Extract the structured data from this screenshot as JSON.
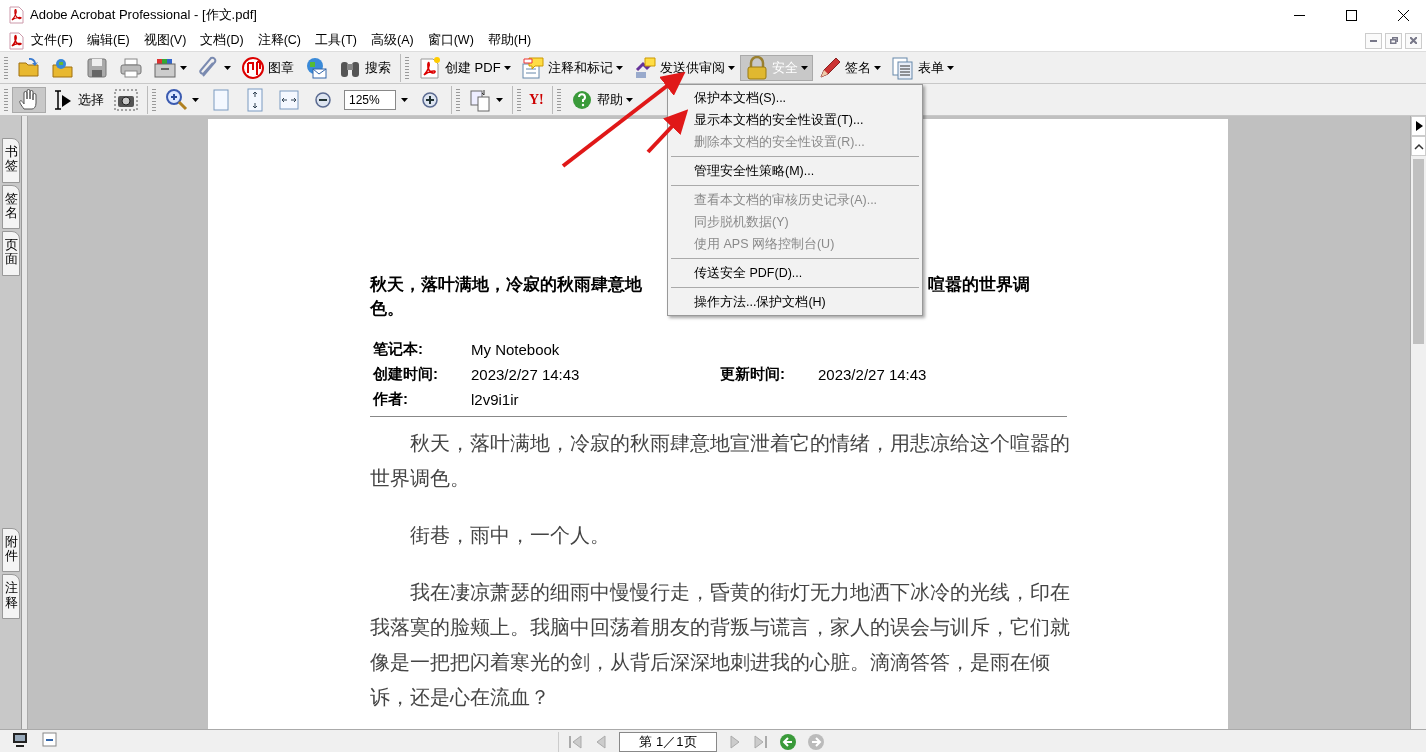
{
  "window": {
    "title": "Adobe Acrobat Professional - [作文.pdf]"
  },
  "menu_bar": [
    "文件(F)",
    "编辑(E)",
    "视图(V)",
    "文档(D)",
    "注释(C)",
    "工具(T)",
    "高级(A)",
    "窗口(W)",
    "帮助(H)"
  ],
  "toolbar_1": [
    {
      "kind": "icon",
      "selected": false
    },
    {
      "kind": "icon",
      "selected": false
    },
    {
      "kind": "icon",
      "selected": false
    },
    {
      "kind": "icon",
      "selected": false
    },
    {
      "kind": "dropdown",
      "selected": false
    },
    {
      "kind": "dropdown",
      "selected": false
    },
    {
      "kind": "labeled",
      "label": "图章",
      "selected": false
    },
    {
      "kind": "icon",
      "selected": false
    },
    {
      "kind": "labeled",
      "label": "搜索",
      "selected": false
    },
    {
      "kind": "separator"
    },
    {
      "kind": "labeled-dropdown",
      "label": "创建 PDF",
      "selected": false
    },
    {
      "kind": "labeled-dropdown",
      "label": "注释和标记",
      "selected": false
    },
    {
      "kind": "labeled-dropdown",
      "label": "发送供审阅",
      "selected": false
    },
    {
      "kind": "labeled-dropdown",
      "label": "安全",
      "selected": true
    },
    {
      "kind": "labeled-dropdown",
      "label": "签名",
      "selected": false
    },
    {
      "kind": "labeled-dropdown",
      "label": "表单",
      "selected": false
    }
  ],
  "toolbar_2": [
    {
      "kind": "icon",
      "selected": true
    },
    {
      "kind": "labeled",
      "label": "选择",
      "selected": false
    },
    {
      "kind": "icon",
      "selected": false
    },
    {
      "kind": "separator"
    },
    {
      "kind": "dropdown",
      "selected": false
    },
    {
      "kind": "icon",
      "selected": false
    },
    {
      "kind": "icon",
      "selected": false
    },
    {
      "kind": "icon",
      "selected": false
    },
    {
      "kind": "icon",
      "selected": false
    },
    {
      "kind": "zoom-field",
      "value": "125%"
    },
    {
      "kind": "icon",
      "selected": false
    },
    {
      "kind": "separator"
    },
    {
      "kind": "dropdown",
      "selected": false
    },
    {
      "kind": "separator"
    },
    {
      "kind": "text-logo",
      "label": "Y!"
    },
    {
      "kind": "separator"
    },
    {
      "kind": "labeled-dropdown",
      "label": "帮助",
      "selected": false
    }
  ],
  "side_tabs_top": [
    "书签",
    "签名",
    "页面"
  ],
  "side_tabs_bottom": [
    "附件",
    "注释"
  ],
  "security_menu": [
    {
      "kind": "item",
      "label": "保护本文档(S)...",
      "disabled": false
    },
    {
      "kind": "item",
      "label": "显示本文档的安全性设置(T)...",
      "disabled": false
    },
    {
      "kind": "item",
      "label": "删除本文档的安全性设置(R)...",
      "disabled": true
    },
    {
      "kind": "separator"
    },
    {
      "kind": "item",
      "label": "管理安全性策略(M)...",
      "disabled": false
    },
    {
      "kind": "separator"
    },
    {
      "kind": "item",
      "label": "查看本文档的审核历史记录(A)...",
      "disabled": true
    },
    {
      "kind": "item",
      "label": "同步脱机数据(Y)",
      "disabled": true
    },
    {
      "kind": "item",
      "label": "使用 APS 网络控制台(U)",
      "disabled": true
    },
    {
      "kind": "separator"
    },
    {
      "kind": "item",
      "label": "传送安全 PDF(D)...",
      "disabled": false
    },
    {
      "kind": "separator"
    },
    {
      "kind": "item",
      "label": "操作方法...保护文档(H)",
      "disabled": false
    }
  ],
  "document": {
    "heading_left": "秋天，落叶满地，冷寂的秋雨肆意地",
    "heading_right": "喧嚣的世界调",
    "heading_line_2": "色。",
    "meta": [
      [
        {
          "label": "笔记本:",
          "value": "My Notebook"
        }
      ],
      [
        {
          "label": "创建时间:",
          "value": "2023/2/27 14:43"
        },
        {
          "label": "更新时间:",
          "value": "2023/2/27 14:43"
        }
      ],
      [
        {
          "label": "作者:",
          "value": "l2v9i1ir"
        }
      ]
    ],
    "paragraphs": [
      "秋天，落叶满地，冷寂的秋雨肆意地宣泄着它的情绪，用悲凉给这个喧嚣的世界调色。",
      "街巷，雨中，一个人。",
      "我在凄凉萧瑟的细雨中慢慢行走，昏黄的街灯无力地洒下冰冷的光线，印在我落寞的脸颊上。我脑中回荡着朋友的背叛与谎言，家人的误会与训斥，它们就像是一把把闪着寒光的剑，从背后深深地刺进我的心脏。滴滴答答，是雨在倾诉，还是心在流血？"
    ]
  },
  "status_bar": {
    "page_field": "第 1／1页"
  }
}
